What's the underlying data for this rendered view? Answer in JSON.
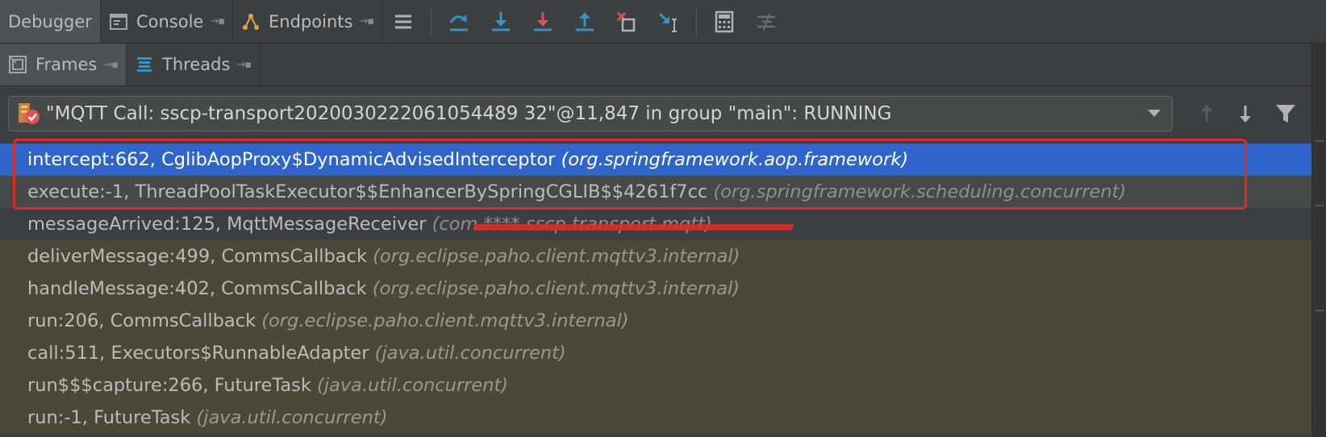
{
  "toolbar": {
    "tabs": [
      {
        "label": "Debugger",
        "icon": "none"
      },
      {
        "label": "Console",
        "icon": "console-icon"
      },
      {
        "label": "Endpoints",
        "icon": "endpoints-icon"
      }
    ],
    "buttons": [
      "show-execution-point-icon",
      "step-over-icon",
      "step-into-icon",
      "force-step-into-icon",
      "step-out-icon",
      "drop-frame-icon",
      "run-to-cursor-icon",
      "evaluate-expression-icon",
      "trace-current-stream-icon"
    ]
  },
  "subtabs": [
    {
      "label": "Frames",
      "icon": "frames-icon"
    },
    {
      "label": "Threads",
      "icon": "threads-icon"
    }
  ],
  "thread": {
    "label": "\"MQTT Call: sscp-transport2020030222061054489 32\"@11,847 in group \"main\": RUNNING"
  },
  "frames": [
    {
      "method": "intercept:662, CglibAopProxy$DynamicAdvisedInterceptor",
      "pkg": "(org.springframework.aop.framework)"
    },
    {
      "method": "execute:-1, ThreadPoolTaskExecutor$$EnhancerBySpringCGLIB$$4261f7cc",
      "pkg": "(org.springframework.scheduling.concurrent)"
    },
    {
      "method": "messageArrived:125, MqttMessageReceiver",
      "pkg": "(com.****.sscp.transport.mqtt)"
    },
    {
      "method": "deliverMessage:499, CommsCallback",
      "pkg": "(org.eclipse.paho.client.mqttv3.internal)"
    },
    {
      "method": "handleMessage:402, CommsCallback",
      "pkg": "(org.eclipse.paho.client.mqttv3.internal)"
    },
    {
      "method": "run:206, CommsCallback",
      "pkg": "(org.eclipse.paho.client.mqttv3.internal)"
    },
    {
      "method": "call:511, Executors$RunnableAdapter",
      "pkg": "(java.util.concurrent)"
    },
    {
      "method": "run$$$capture:266, FutureTask",
      "pkg": "(java.util.concurrent)"
    },
    {
      "method": "run:-1, FutureTask",
      "pkg": "(java.util.concurrent)"
    }
  ],
  "colors": {
    "selected": "#2f65ca",
    "highlight_border": "#e02b22",
    "library_frame_bg": "#4b4838"
  }
}
